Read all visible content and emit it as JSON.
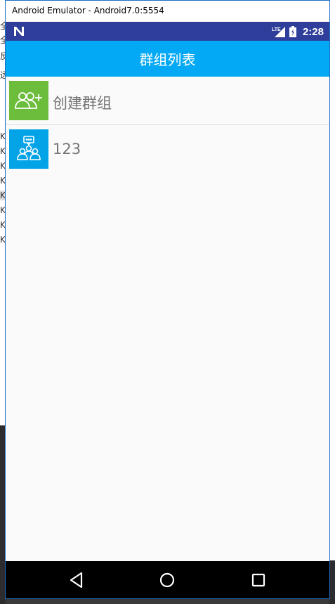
{
  "window": {
    "title": "Android Emulator - Android7.0:5554"
  },
  "status_bar": {
    "time": "2:28",
    "network_label": "LTE",
    "icons": [
      "n-logo-icon",
      "lte-signal-icon",
      "battery-icon"
    ],
    "background": "#2e3e9a"
  },
  "app_bar": {
    "title": "群组列表",
    "background": "#03a9f4"
  },
  "list": {
    "items": [
      {
        "label": "创建群组",
        "icon": "add-group-icon",
        "icon_bg": "#6bbd3b"
      },
      {
        "label": "123",
        "icon": "group-chat-icon",
        "icon_bg": "#03a3e8"
      }
    ]
  },
  "nav_bar": {
    "buttons": [
      "back-icon",
      "home-icon",
      "recents-icon"
    ]
  },
  "background_window": {
    "left_fragments": [
      "全",
      "全",
      "反",
      "远",
      "Kl",
      "Kl",
      "Kl",
      "Kl",
      "Kl",
      "Kl",
      "Kl",
      "Kl"
    ]
  }
}
